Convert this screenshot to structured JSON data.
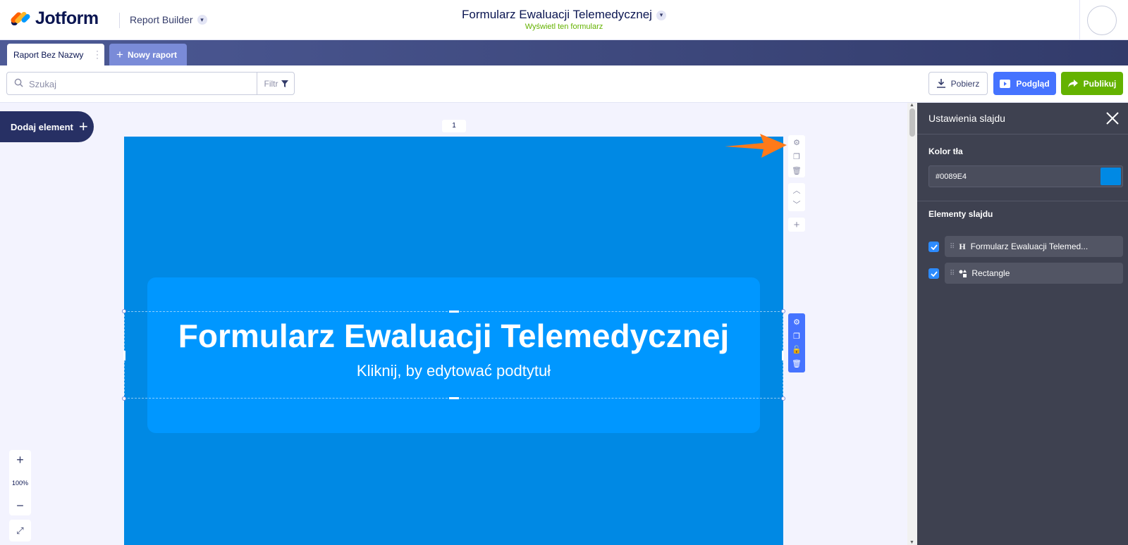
{
  "header": {
    "brand": "Jotform",
    "app_switcher": "Report Builder",
    "form_title": "Formularz Ewaluacji Telemedycznej",
    "form_subtitle": "Wyświetl ten formularz"
  },
  "tabs": {
    "active": "Raport Bez Nazwy",
    "new_report": "Nowy raport"
  },
  "toolbar": {
    "search_placeholder": "Szukaj",
    "filter_label": "Filtr",
    "download_label": "Pobierz",
    "preview_label": "Podgląd",
    "publish_label": "Publikuj"
  },
  "canvas": {
    "add_element_label": "Dodaj element",
    "page_number": "1",
    "zoom_level": "100%",
    "slide": {
      "title": "Formularz Ewaluacji Telemedycznej",
      "subtitle": "Kliknij, by edytować podtytuł",
      "background": "#0089E4"
    }
  },
  "panel": {
    "title": "Ustawienia slajdu",
    "bg_color_label": "Kolor tła",
    "bg_color_value": "#0089E4",
    "elements_label": "Elementy slajdu",
    "elements": [
      {
        "icon": "heading-icon",
        "label": "Formularz Ewaluacji Telemed...",
        "checked": true
      },
      {
        "icon": "shapes-icon",
        "label": "Rectangle",
        "checked": true
      }
    ]
  },
  "colors": {
    "accent_blue": "#4573ff",
    "publish_green": "#64b200",
    "navy": "#273064",
    "panel_bg": "#3e4150",
    "highlight_arrow": "#ff7a1a"
  }
}
